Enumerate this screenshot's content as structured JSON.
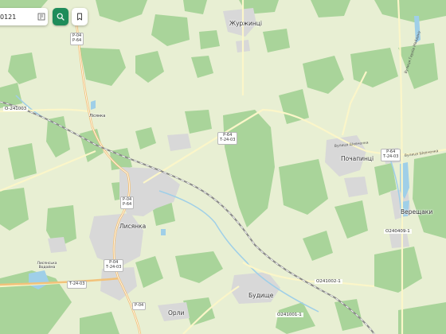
{
  "search": {
    "value": "0121"
  },
  "colors": {
    "background": "#e8efd3",
    "forest": "#a9d49a",
    "urban": "#d8d8d8",
    "water": "#9fcfe8",
    "highway": "#f2c27a",
    "minor_road": "#fbf6c9",
    "railway": "#8a8a8a",
    "search_button": "#1e8c5a"
  },
  "icons": {
    "search": "search-icon",
    "bookmark": "bookmark-icon",
    "coordinates": "coordinates-icon"
  },
  "places": {
    "zhurzhytsi": "Журжинці",
    "lysianka": "Лисянка",
    "pochaptyntsi": "Почапинці",
    "vereshchaky": "Верещаки",
    "budyshche": "Будище",
    "orly": "Орли",
    "lysianka_small": "Лісянка",
    "pond": "Лисянська Водойма"
  },
  "shields": {
    "p04_top": [
      "Р-04",
      "Р-64"
    ],
    "p64_mid": [
      "Р-64",
      "Т-24-03"
    ],
    "p64_town": [
      "Р-04",
      "Р-64"
    ],
    "p04_south": [
      "Р-04",
      "Т-24-03"
    ],
    "p64_east": [
      "Р-64",
      "Т-24-03"
    ],
    "p04_bottom": [
      "Р-04"
    ],
    "t2403_west": [
      "Т-24-03"
    ]
  },
  "road_ids": {
    "west": "О-241003",
    "vereshchaky": "О240409-1",
    "budyshche_east": "О241002-1",
    "budyshche_south": "О241001-1"
  },
  "streets": {
    "pochaptyntsi_1": "Вулиця Шевченка",
    "pochaptyntsi_2": "Вулиця Шевченка",
    "northeast": "Вулиця Героїв Майдану"
  }
}
